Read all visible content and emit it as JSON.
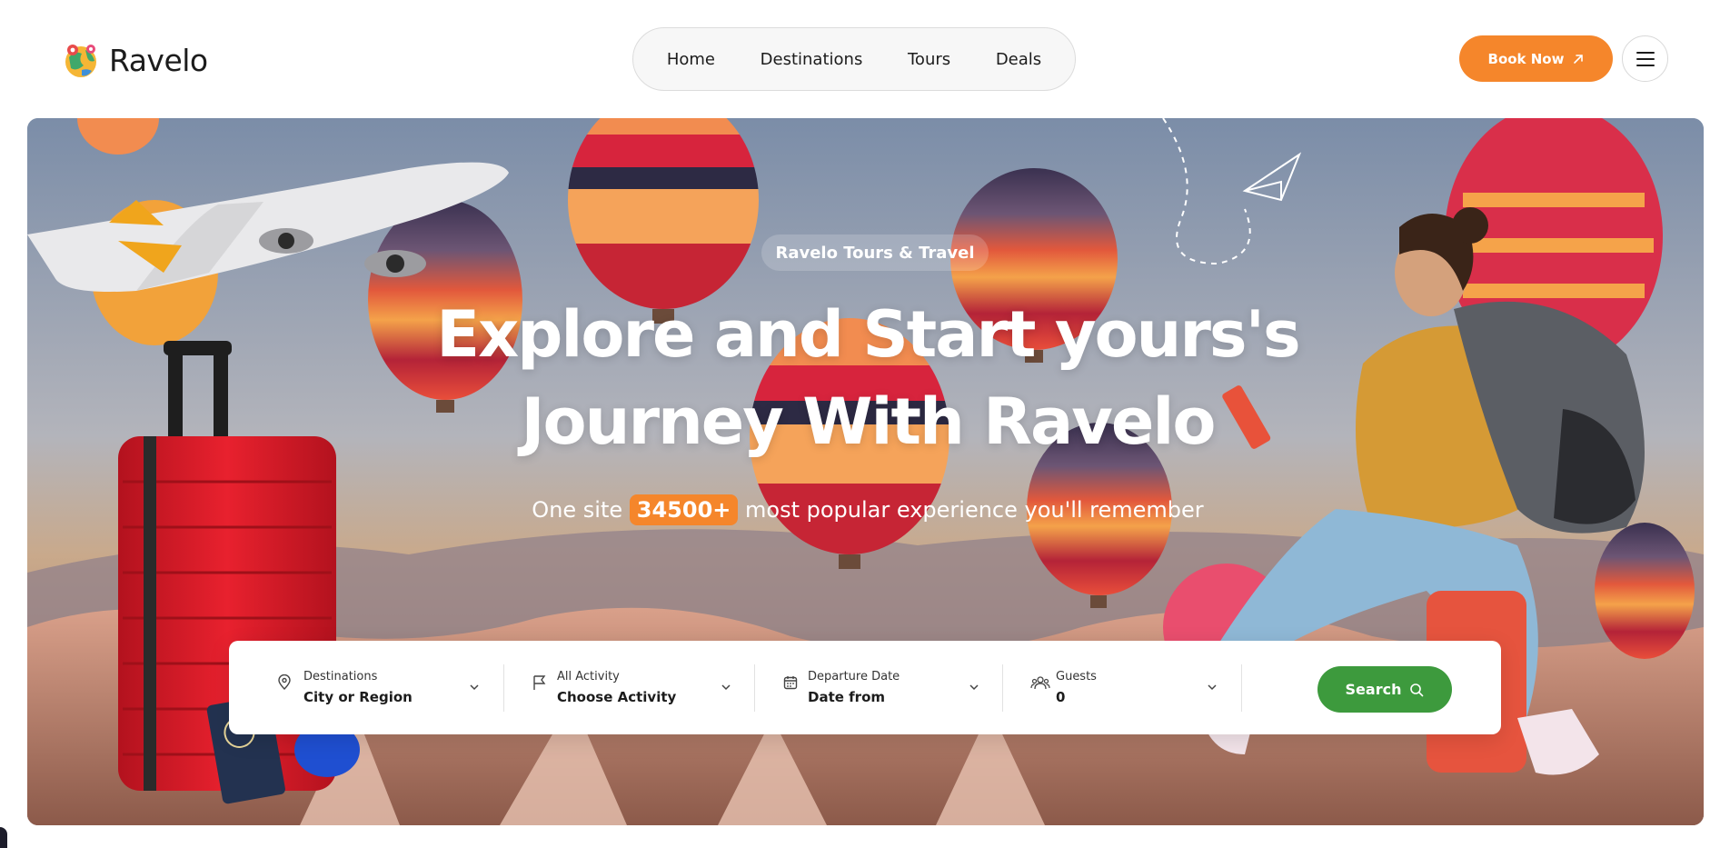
{
  "brand": {
    "name": "Ravelo"
  },
  "nav": {
    "items": [
      {
        "label": "Home"
      },
      {
        "label": "Destinations"
      },
      {
        "label": "Tours"
      },
      {
        "label": "Deals"
      }
    ]
  },
  "header": {
    "book_label": "Book Now"
  },
  "hero": {
    "tag": "Ravelo Tours & Travel",
    "title_line1": "Explore and Start yours's",
    "title_line2": "Journey With Ravelo",
    "sub_before": "One site",
    "sub_count": "34500+",
    "sub_after": "most popular experience you'll remember"
  },
  "search": {
    "destination": {
      "label": "Destinations",
      "value": "City or Region",
      "icon": "map-pin-icon"
    },
    "activity": {
      "label": "All Activity",
      "value": "Choose Activity",
      "icon": "flag-icon"
    },
    "date": {
      "label": "Departure Date",
      "value": "Date from",
      "icon": "calendar-icon"
    },
    "guests": {
      "label": "Guests",
      "value": "0",
      "icon": "users-icon"
    },
    "button_label": "Search"
  },
  "colors": {
    "accent_orange": "#f5862b",
    "search_green": "#3d9a3d",
    "text_dark": "#1c1c1c"
  }
}
